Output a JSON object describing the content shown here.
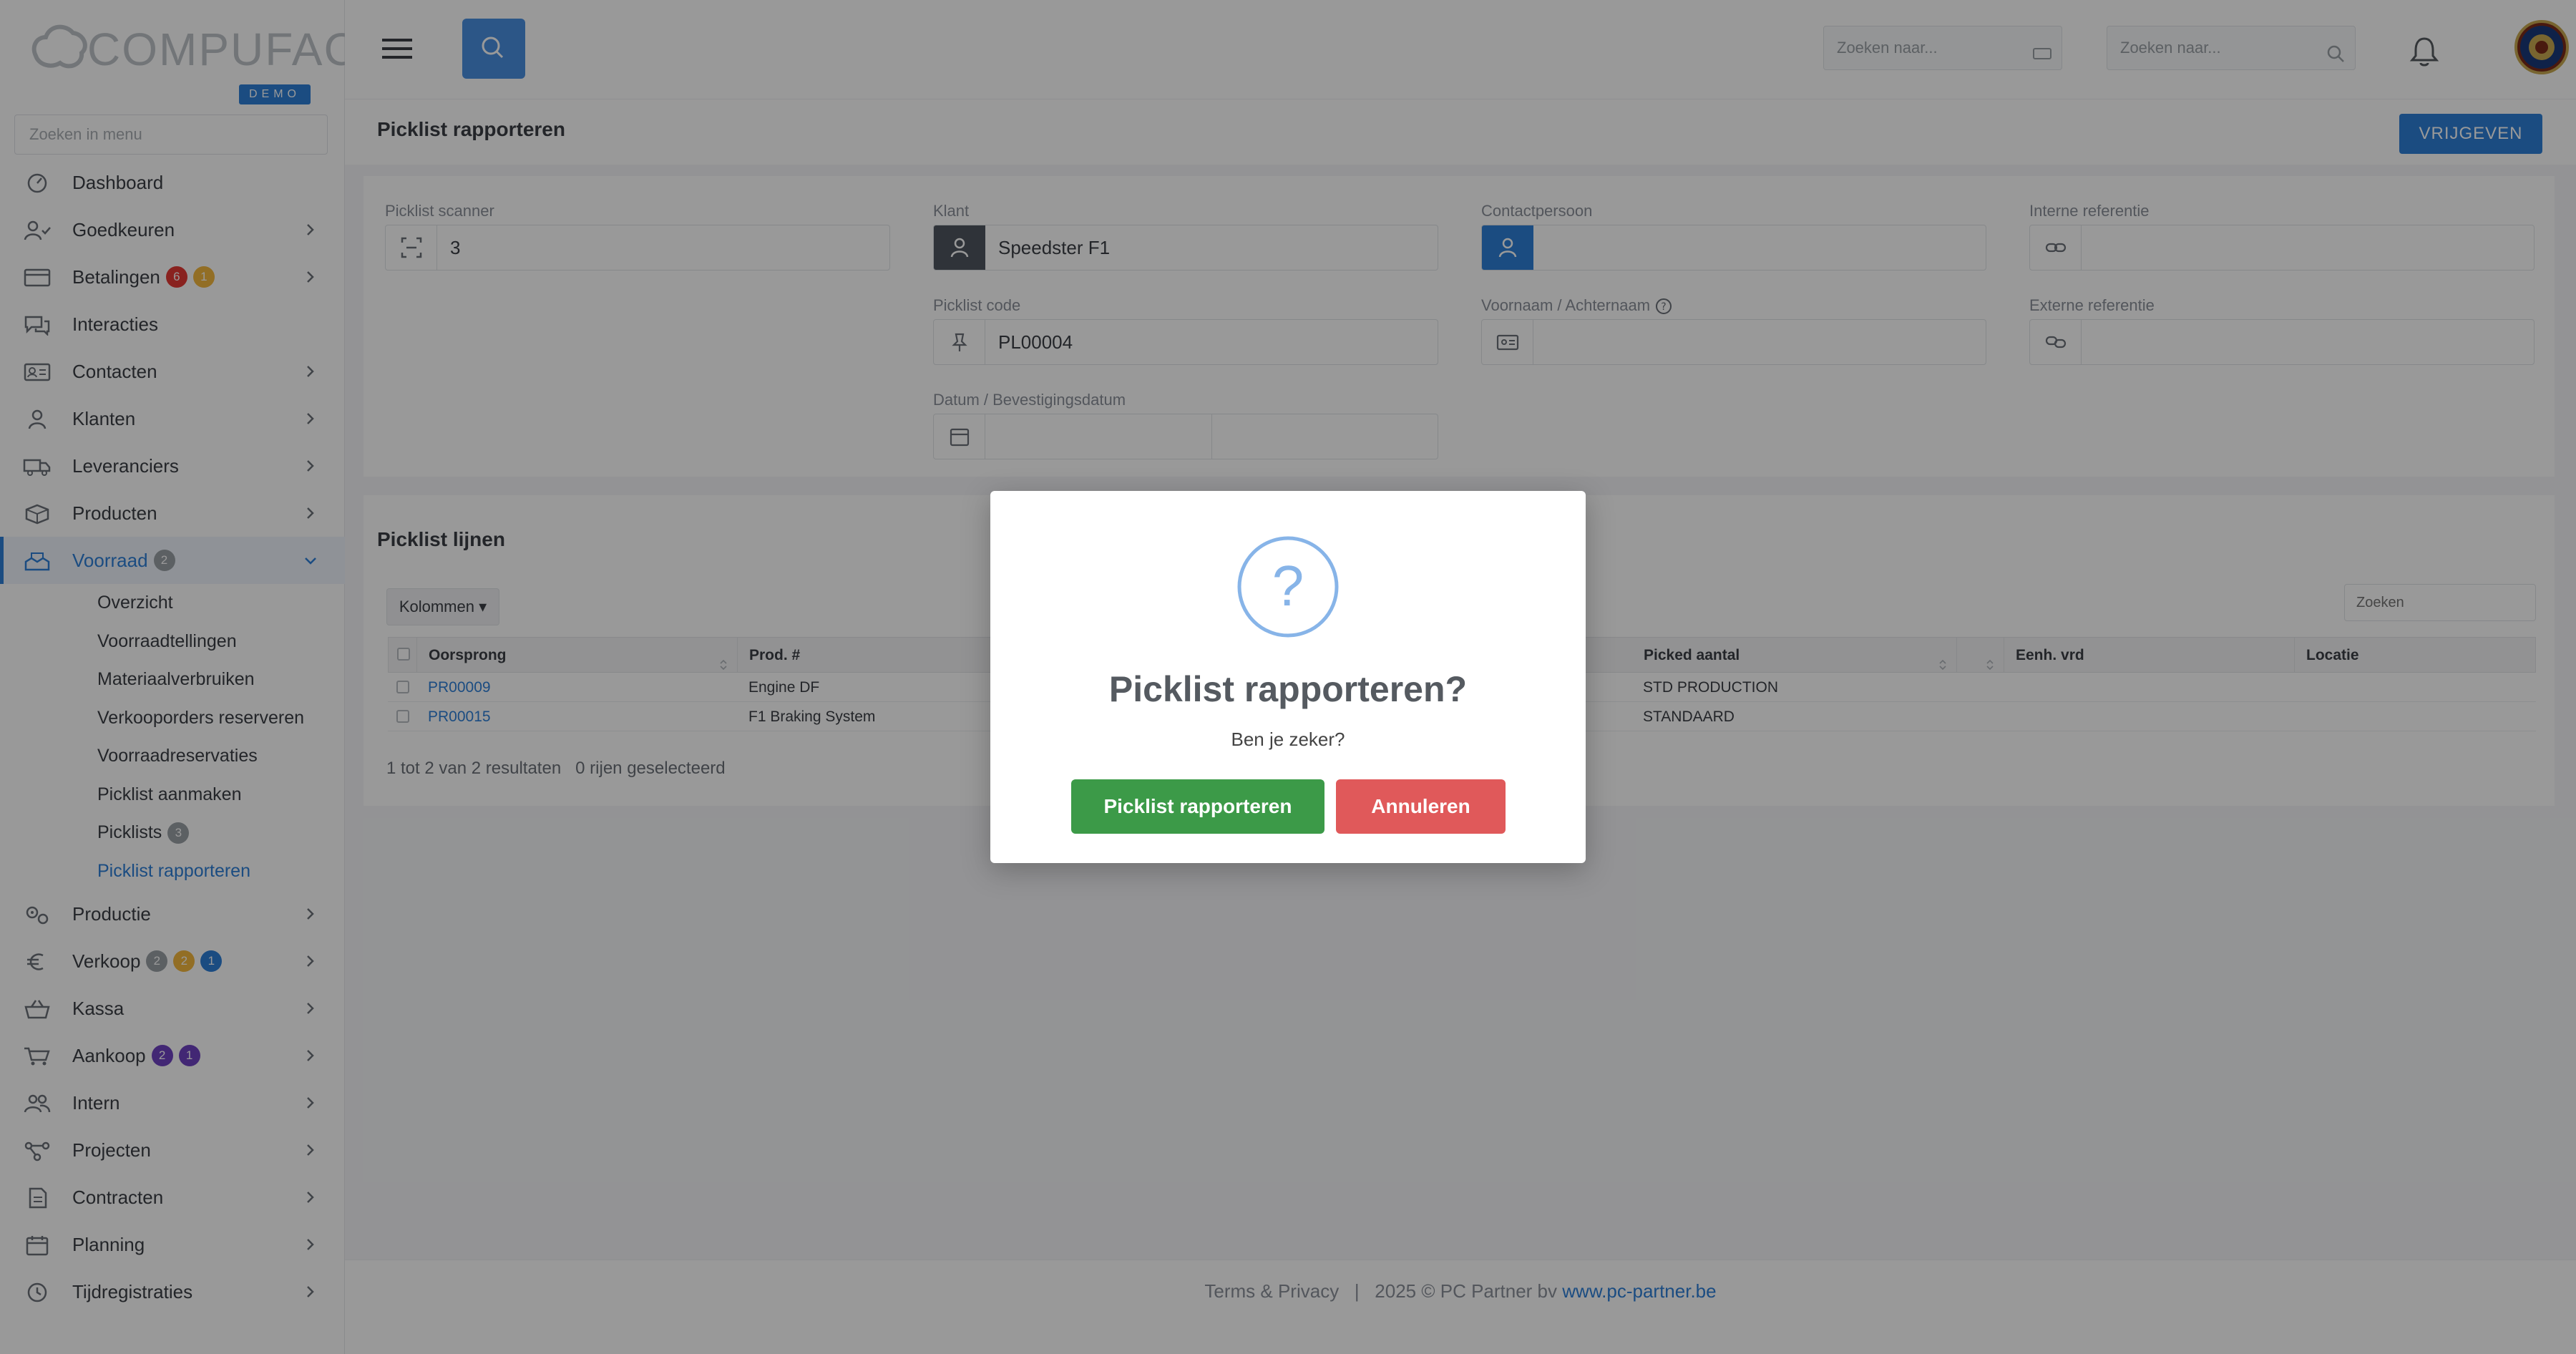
{
  "brand": {
    "logo_text": "COMPUFACT",
    "env_badge": "DEMO"
  },
  "sidebar": {
    "search_placeholder": "Zoeken in menu",
    "items": [
      {
        "label": "Dashboard",
        "icon": "dashboard-icon"
      },
      {
        "label": "Goedkeuren",
        "icon": "user-check-icon"
      },
      {
        "label": "Betalingen",
        "icon": "credit-card-icon",
        "badges": [
          "6",
          "1"
        ]
      },
      {
        "label": "Interacties",
        "icon": "chat-icon"
      },
      {
        "label": "Contacten",
        "icon": "contact-card-icon"
      },
      {
        "label": "Klanten",
        "icon": "user-icon"
      },
      {
        "label": "Leveranciers",
        "icon": "truck-icon"
      },
      {
        "label": "Producten",
        "icon": "box-icon"
      },
      {
        "label": "Voorraad",
        "icon": "boxes-icon",
        "badges": [
          "2"
        ]
      },
      {
        "label": "Productie",
        "icon": "gears-icon"
      },
      {
        "label": "Verkoop",
        "icon": "euro-icon",
        "badges": [
          "2",
          "2",
          "1"
        ]
      },
      {
        "label": "Kassa",
        "icon": "basket-icon"
      },
      {
        "label": "Aankoop",
        "icon": "cart-icon",
        "badges": [
          "2",
          "1"
        ]
      },
      {
        "label": "Intern",
        "icon": "users-icon"
      },
      {
        "label": "Projecten",
        "icon": "project-icon"
      },
      {
        "label": "Contracten",
        "icon": "contract-icon"
      },
      {
        "label": "Planning",
        "icon": "calendar-icon"
      },
      {
        "label": "Tijdregistraties",
        "icon": "clock-icon"
      }
    ],
    "voorraad_sub": [
      {
        "label": "Overzicht"
      },
      {
        "label": "Voorraadtellingen"
      },
      {
        "label": "Materiaalverbruiken"
      },
      {
        "label": "Verkooporders reserveren"
      },
      {
        "label": "Voorraadreservaties"
      },
      {
        "label": "Picklist aanmaken"
      },
      {
        "label": "Picklists",
        "badge": "3"
      },
      {
        "label": "Picklist rapporteren"
      }
    ]
  },
  "topbar": {
    "search1_placeholder": "Zoeken naar...",
    "search2_placeholder": "Zoeken naar..."
  },
  "page": {
    "title": "Picklist rapporteren",
    "release_button": "VRIJGEVEN"
  },
  "form": {
    "picklist_scanner": {
      "label": "Picklist scanner",
      "value": "3"
    },
    "klant": {
      "label": "Klant",
      "value": "Speedster F1"
    },
    "contactpersoon": {
      "label": "Contactpersoon",
      "value": ""
    },
    "interne_referentie": {
      "label": "Interne referentie",
      "value": ""
    },
    "picklist_code": {
      "label": "Picklist code",
      "value": "PL00004"
    },
    "voornaam_achternaam": {
      "label": "Voornaam / Achternaam",
      "value": ""
    },
    "externe_referentie": {
      "label": "Externe referentie",
      "value": ""
    },
    "datum": {
      "label": "Datum / Bevestigingsdatum",
      "value": ""
    }
  },
  "lines": {
    "title": "Picklist lijnen",
    "columns_button": "Kolommen",
    "filter_placeholder": "Zoeken",
    "headers": [
      "Oorsprong",
      "Prod. #",
      "Picked aantal",
      "Eenh. vrd",
      "Locatie"
    ],
    "rows": [
      {
        "oorsprong": "PR00009",
        "prod": "Engine DF",
        "picked": "STD PRODUCTION",
        "eenh": "",
        "locatie": ""
      },
      {
        "oorsprong": "PR00015",
        "prod": "F1 Braking System",
        "picked": "STANDAARD",
        "eenh": "",
        "locatie": ""
      }
    ],
    "footer_text": "1 tot 2 van 2 resultaten   0 rijen geselecteerd"
  },
  "footer": {
    "text": "Terms & Privacy   |   2025 © PC Partner bv",
    "link": "www.pc-partner.be"
  },
  "modal": {
    "title": "Picklist rapporteren?",
    "text": "Ben je zeker?",
    "confirm": "Picklist rapporteren",
    "cancel": "Annuleren",
    "icon": "question-icon"
  },
  "colors": {
    "accent": "#2d7fd8",
    "confirm": "#3c9a48",
    "cancel": "#e0595a",
    "overlay": "rgba(0,0,0,0.40)"
  }
}
